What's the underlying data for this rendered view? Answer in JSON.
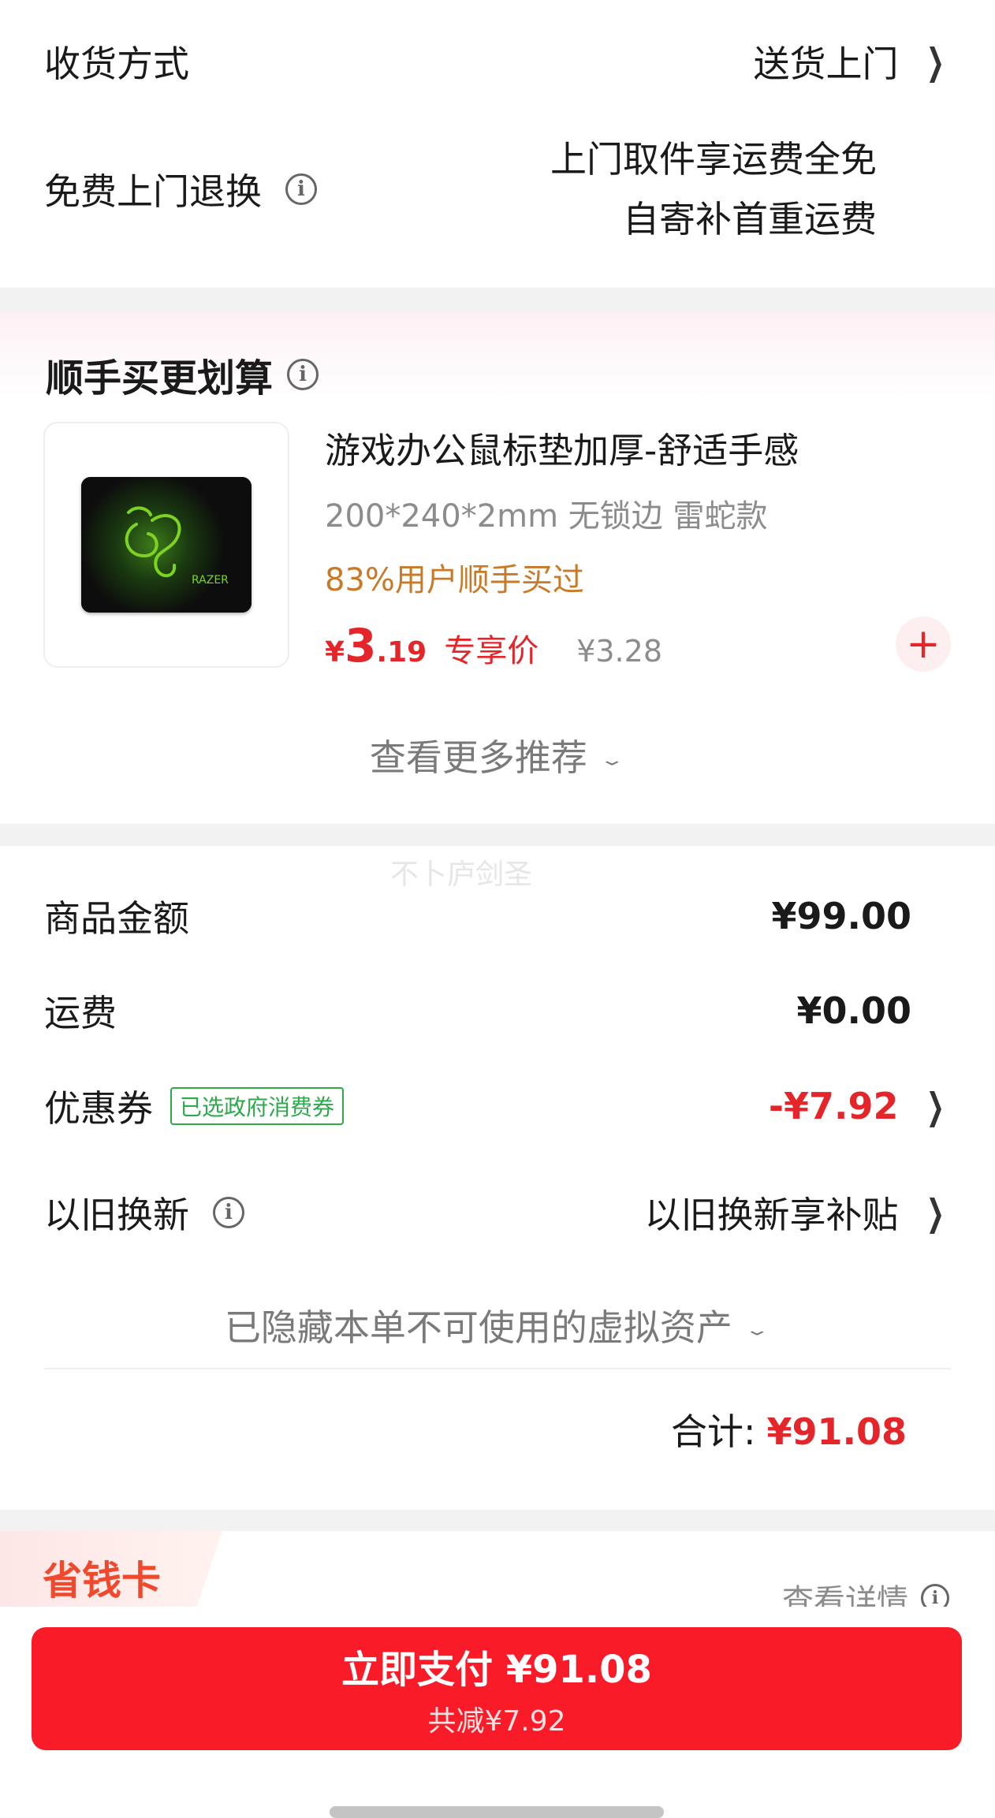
{
  "delivery": {
    "method_label": "收货方式",
    "method_value": "送货上门",
    "return_label": "免费上门退换",
    "return_line1": "上门取件享运费全免",
    "return_line2": "自寄补首重运费"
  },
  "recommend": {
    "title": "顺手买更划算",
    "product": {
      "name": "游戏办公鼠标垫加厚-舒适手感",
      "spec": "200*240*2mm 无锁边 雷蛇款",
      "social_proof": "83%用户顺手买过",
      "currency": "¥",
      "price_int": "3",
      "price_dec": ".19",
      "price_tag": "专享价",
      "original_price": "¥3.28",
      "image_brand": "RAZER"
    },
    "more_label": "查看更多推荐"
  },
  "watermark": "不卜庐剑圣",
  "summary": {
    "goods_label": "商品金额",
    "goods_value": "¥99.00",
    "shipping_label": "运费",
    "shipping_value": "¥0.00",
    "coupon_label": "优惠券",
    "coupon_tag": "已选政府消费券",
    "coupon_value": "-¥7.92",
    "tradein_label": "以旧换新",
    "tradein_value": "以旧换新享补贴",
    "hidden_assets": "已隐藏本单不可使用的虚拟资产",
    "total_label": "合计:",
    "total_value": "¥91.08"
  },
  "saving_card": {
    "title": "省钱卡",
    "detail": "查看详情"
  },
  "pay": {
    "main": "立即支付 ¥91.08",
    "sub": "共减¥7.92"
  },
  "colors": {
    "accent_red": "#e4262a",
    "pay_button": "#fa1b28",
    "coupon_green": "#2da84a",
    "social_orange": "#c97a28"
  },
  "icons": {
    "chevron_right": "chevron-right-icon",
    "chevron_down": "chevron-down-icon",
    "info": "info-icon",
    "plus": "plus-icon"
  }
}
